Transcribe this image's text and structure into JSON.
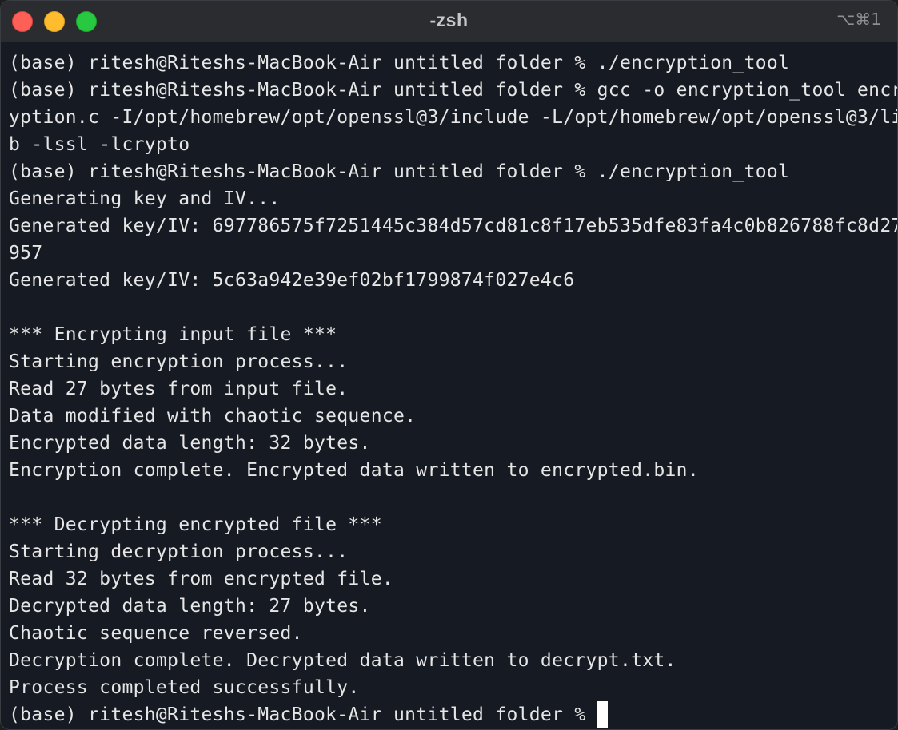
{
  "window": {
    "title": "-zsh",
    "shortcut": "⌥⌘1"
  },
  "terminal": {
    "lines": [
      "(base) ritesh@Riteshs-MacBook-Air untitled folder % ./encryption_tool",
      "(base) ritesh@Riteshs-MacBook-Air untitled folder % gcc -o encryption_tool encr",
      "yption.c -I/opt/homebrew/opt/openssl@3/include -L/opt/homebrew/opt/openssl@3/li",
      "b -lssl -lcrypto",
      "(base) ritesh@Riteshs-MacBook-Air untitled folder % ./encryption_tool",
      "Generating key and IV...",
      "Generated key/IV: 697786575f7251445c384d57cd81c8f17eb535dfe83fa4c0b826788fc8d27",
      "957",
      "Generated key/IV: 5c63a942e39ef02bf1799874f027e4c6",
      "",
      "*** Encrypting input file ***",
      "Starting encryption process...",
      "Read 27 bytes from input file.",
      "Data modified with chaotic sequence.",
      "Encrypted data length: 32 bytes.",
      "Encryption complete. Encrypted data written to encrypted.bin.",
      "",
      "*** Decrypting encrypted file ***",
      "Starting decryption process...",
      "Read 32 bytes from encrypted file.",
      "Decrypted data length: 27 bytes.",
      "Chaotic sequence reversed.",
      "Decryption complete. Decrypted data written to decrypt.txt.",
      "Process completed successfully."
    ],
    "prompt": "(base) ritesh@Riteshs-MacBook-Air untitled folder % "
  }
}
